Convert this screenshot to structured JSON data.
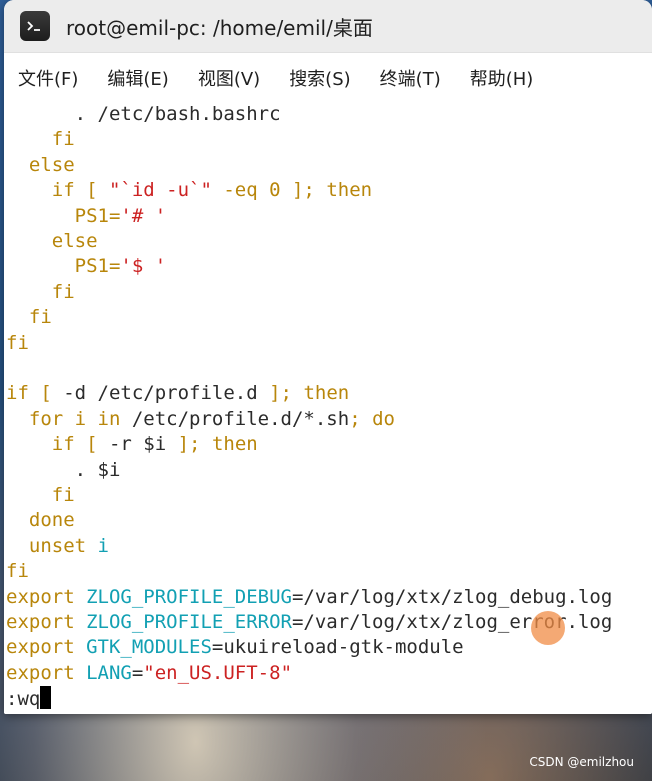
{
  "window": {
    "title": "root@emil-pc: /home/emil/桌面",
    "app_icon": "terminal-icon"
  },
  "menu": {
    "items": [
      "文件(F)",
      "编辑(E)",
      "视图(V)",
      "搜索(S)",
      "终端(T)",
      "帮助(H)"
    ]
  },
  "terminal": {
    "lines": [
      [
        "      ",
        "",
        ". /etc/bash.bashrc",
        ""
      ],
      [
        "    ",
        "fi",
        "",
        ""
      ],
      [
        "  ",
        "else",
        "",
        ""
      ],
      [
        "    ",
        "if [ ",
        "\"`id -u`\"",
        " -eq 0 ]; then"
      ],
      [
        "      ",
        "",
        "PS1='# '",
        ""
      ],
      [
        "    ",
        "else",
        "",
        ""
      ],
      [
        "      ",
        "",
        "PS1='$ '",
        ""
      ],
      [
        "    ",
        "fi",
        "",
        ""
      ],
      [
        "  ",
        "fi",
        "",
        ""
      ],
      [
        "",
        "fi",
        "",
        ""
      ],
      [
        "",
        "",
        "",
        ""
      ],
      [
        "",
        "if [ ",
        "-d /etc/profile.d",
        " ]; then"
      ],
      [
        "  ",
        "for i in ",
        "/etc/profile.d/*.sh",
        "; do"
      ],
      [
        "    ",
        "if [ ",
        "-r $i",
        " ]; then"
      ],
      [
        "      ",
        "",
        ". $i",
        ""
      ],
      [
        "    ",
        "fi",
        "",
        ""
      ],
      [
        "  ",
        "done",
        "",
        ""
      ],
      [
        "  ",
        "unset ",
        "i",
        ""
      ],
      [
        "",
        "fi",
        "",
        ""
      ],
      [
        "",
        "export ",
        "ZLOG_PROFILE_DEBUG",
        "=/var/log/xtx/zlog_debug.log"
      ],
      [
        "",
        "export ",
        "ZLOG_PROFILE_ERROR",
        "=/var/log/xtx/zlog_error.log"
      ],
      [
        "",
        "export ",
        "GTK_MODULES",
        "=ukuireload-gtk-module"
      ],
      [
        "",
        "export ",
        "LANG",
        "=\"en_US.UFT-8\""
      ],
      [
        "",
        ":wq",
        "",
        ""
      ]
    ],
    "command_input": ":wq"
  },
  "colors": {
    "keyword": "#b8860b",
    "string": "#cc2222",
    "variable": "#12a0b3",
    "text": "#2b2b2b"
  },
  "watermark": "CSDN @emilzhou"
}
